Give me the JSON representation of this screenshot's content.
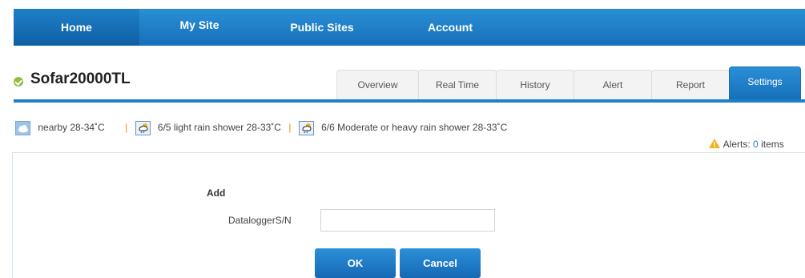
{
  "nav": {
    "items": [
      {
        "label": "Home"
      },
      {
        "label": "My Site"
      },
      {
        "label": "Public Sites"
      },
      {
        "label": "Account"
      }
    ]
  },
  "site": {
    "title": "Sofar20000TL",
    "status_color": "#8fbf3a"
  },
  "tabs": [
    {
      "label": "Overview"
    },
    {
      "label": "Real Time"
    },
    {
      "label": "History"
    },
    {
      "label": "Alert"
    },
    {
      "label": "Report"
    },
    {
      "label": "Settings",
      "active": true
    }
  ],
  "weather": {
    "nearby": "nearby 28-34˚C",
    "day1": "6/5 light rain shower 28-33˚C",
    "day2": "6/6 Moderate or heavy rain shower 28-33˚C",
    "separator": "|"
  },
  "alerts": {
    "prefix": "Alerts:",
    "count": "0",
    "suffix": "items"
  },
  "form": {
    "title": "Add",
    "field_label": "DataloggerS/N",
    "field_value": "",
    "ok_label": "OK",
    "cancel_label": "Cancel"
  },
  "colors": {
    "accent": "#1f7fc8",
    "alert_count": "#1f7fc8"
  }
}
